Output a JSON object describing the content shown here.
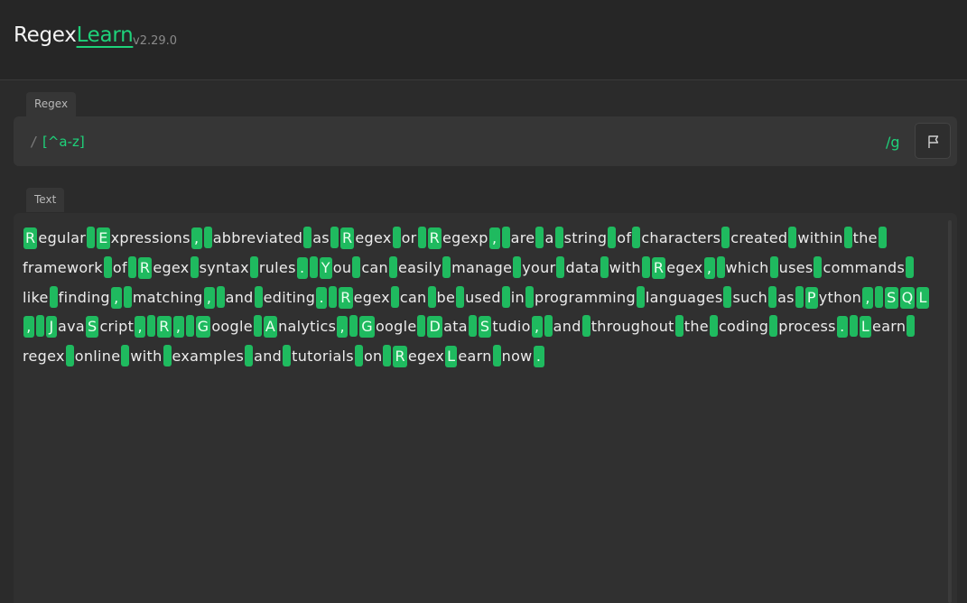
{
  "header": {
    "logo_primary": "Regex",
    "logo_accent": "Learn",
    "version": "v2.29.0"
  },
  "regex": {
    "tab_label": "Regex",
    "open_slash": "/",
    "value": "[^a-z]",
    "flags": "/g"
  },
  "text": {
    "tab_label": "Text",
    "content": "Regular Expressions, abbreviated as Regex or Regexp, are a string of characters created within the framework of Regex syntax rules. You can easily manage your data with Regex, which uses commands like finding, matching, and editing. Regex can be used in programming languages such as Python, SQL, JavaScript, R, Google Analytics, Google Data Studio, and throughout the coding process. Learn regex online with examples and tutorials on RegexLearn now."
  },
  "colors": {
    "accent": "#1ed27a",
    "match_bg": "#1fba5f",
    "panel_bg": "#363636",
    "page_bg": "#2b2b2b"
  }
}
